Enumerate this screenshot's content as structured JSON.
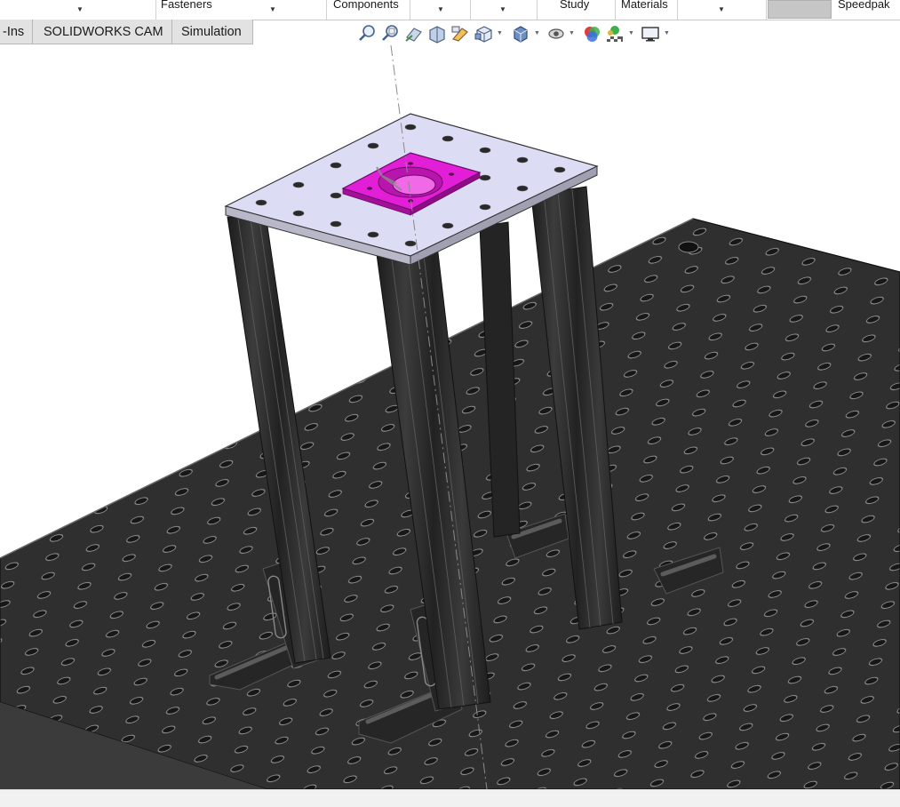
{
  "command_manager": {
    "fasteners_label": "Fasteners",
    "components_label": "Components",
    "study_label": "Study",
    "materials_label": "Materials",
    "speedpak_label": "Speedpak"
  },
  "tabs": [
    {
      "label": "-Ins"
    },
    {
      "label": "SOLIDWORKS CAM"
    },
    {
      "label": "Simulation"
    }
  ],
  "view_toolbar": {
    "icons": [
      "zoom-to-fit-icon",
      "zoom-to-area-icon",
      "previous-view-icon",
      "section-view-icon",
      "dynamic-annotation-icon",
      "view-orientation-icon",
      "display-style-icon",
      "hide-show-icon",
      "edit-appearance-icon",
      "apply-scene-icon",
      "view-settings-icon"
    ]
  },
  "colors": {
    "top_plate": "#dcdcf4",
    "motor_mount": "#e21ed6",
    "breadboard": "#2f2f2f",
    "extrusion": "#2a2a2a",
    "tab_bg": "#e2e2e2"
  }
}
